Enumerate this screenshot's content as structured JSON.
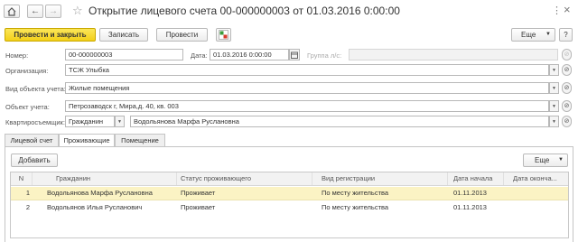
{
  "window": {
    "title": "Открытие лицевого счета 00-000000003 от 01.03.2016 0:00:00",
    "more_menu": "⋮",
    "close": "×"
  },
  "toolbar": {
    "post_close": "Провести и закрыть",
    "save": "Записать",
    "post": "Провести",
    "more": "Еще",
    "help": "?"
  },
  "form": {
    "number_label": "Номер:",
    "number_value": "00-000000003",
    "date_label": "Дата:",
    "date_value": "01.03.2016  0:00:00",
    "group_label": "Группа л/с:",
    "org_label": "Организация:",
    "org_value": "ТСЖ Улыбка",
    "object_kind_label": "Вид объекта учета:",
    "object_kind_value": "Жилые помещения",
    "object_label": "Объект учета:",
    "object_value": "Петрозаводск г, Мира,д. 40, кв. 003",
    "tenant_label": "Квартиросъемщик:",
    "tenant_type": "Гражданин",
    "tenant_value": "Водольянова Марфа Руслановна"
  },
  "tabs": [
    "Лицевой счет",
    "Проживающие",
    "Помещение"
  ],
  "grid": {
    "add_label": "Добавить",
    "more_label": "Еще",
    "columns": [
      "N",
      "Гражданин",
      "Статус проживающего",
      "Вид регистрации",
      "Дата начала",
      "Дата оконча..."
    ],
    "rows": [
      [
        "1",
        "Водольянова Марфа Руслановна",
        "Проживает",
        "По месту жительства",
        "01.11.2013",
        ""
      ],
      [
        "2",
        "Водольянов Илья Русланович",
        "Проживает",
        "По месту жительства",
        "01.11.2013",
        ""
      ]
    ]
  },
  "colors": {
    "accent": "#f3cf18",
    "selected_row": "#fbf3c4"
  }
}
